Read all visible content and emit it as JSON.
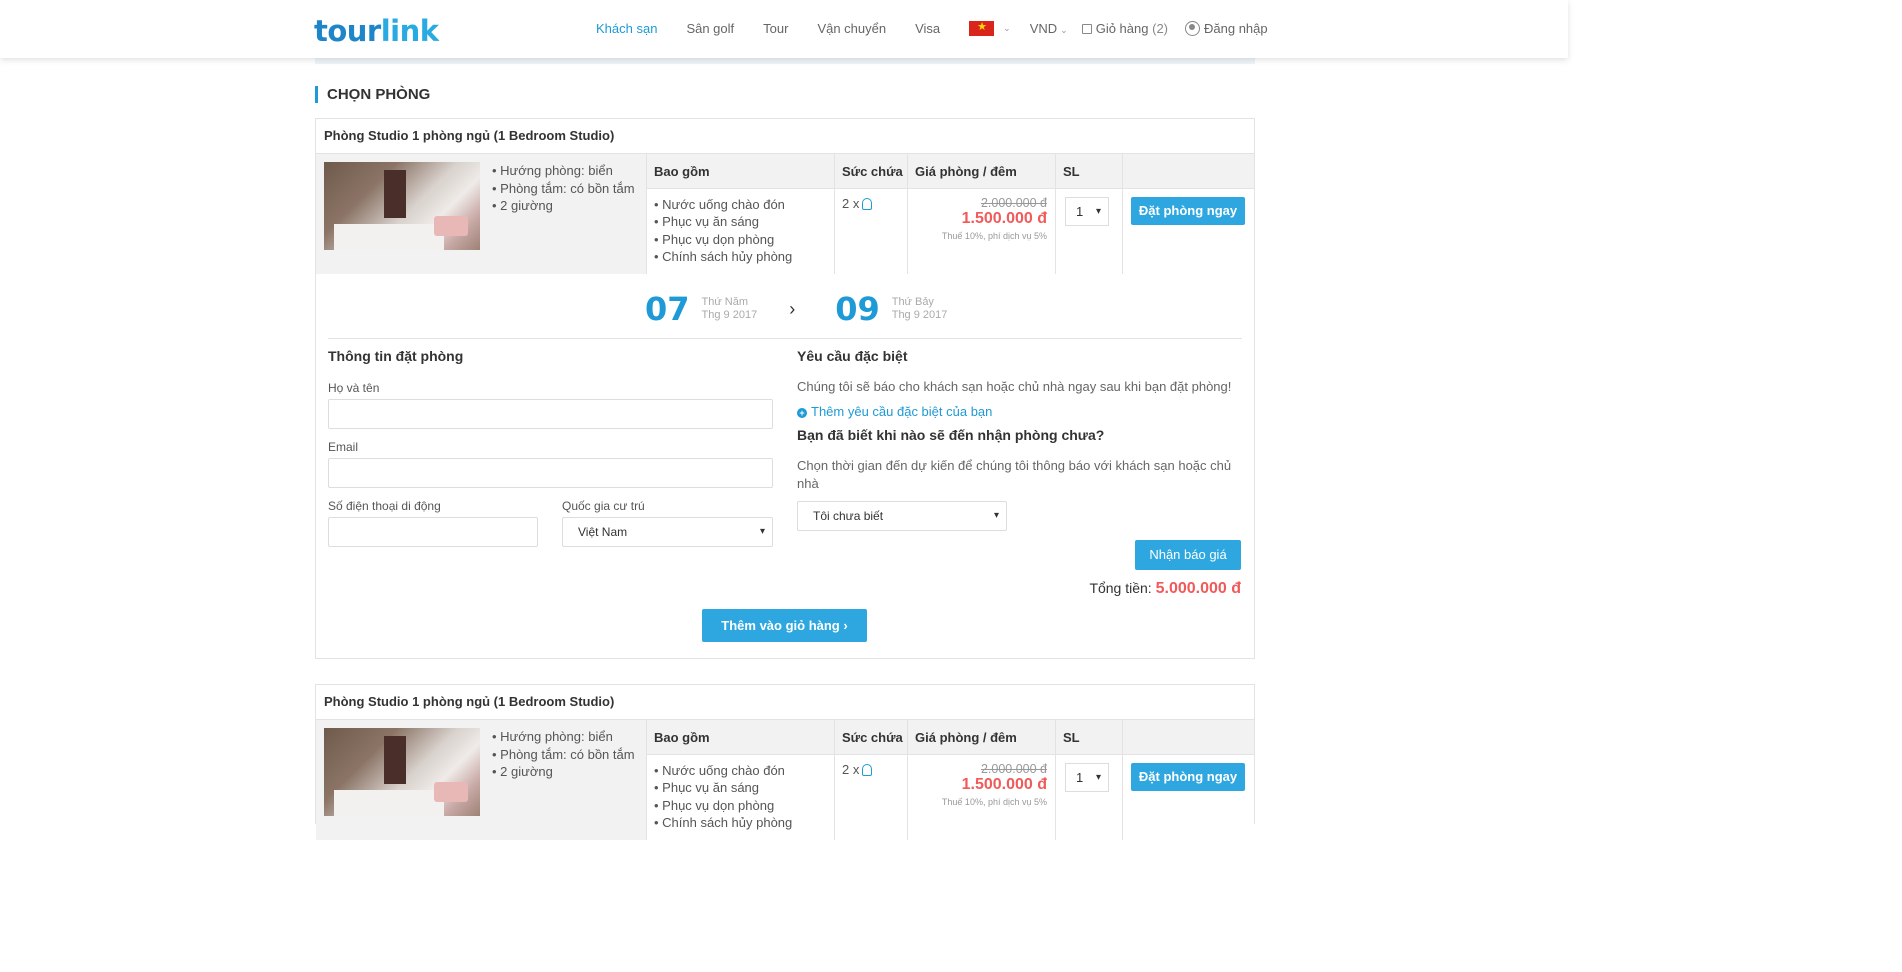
{
  "header": {
    "logo_part1": "tour",
    "logo_part2": "link",
    "nav": [
      "Khách sạn",
      "Sân golf",
      "Tour",
      "Vận chuyển",
      "Visa"
    ],
    "active_nav": "Khách sạn",
    "language_icon": "vietnam-flag-icon",
    "currency": "VND",
    "cart_label": "Giỏ hàng",
    "cart_count": "(2)",
    "login_label": "Đăng nhập"
  },
  "section_title": "CHỌN PHÒNG",
  "room_table_headers": {
    "includes": "Bao gồm",
    "capacity": "Sức chứa",
    "price": "Giá phòng / đêm",
    "qty": "SL"
  },
  "rooms": [
    {
      "title": "Phòng Studio 1 phòng ngủ (1 Bedroom Studio)",
      "features": [
        "• Hướng phòng: biển",
        "• Phòng tắm: có bồn tắm",
        "• 2 giường"
      ],
      "includes": [
        "• Nước uống chào đón",
        "• Phục vụ ăn sáng",
        "• Phục vụ dọn phòng",
        "• Chính sách hủy phòng"
      ],
      "capacity": "2 x",
      "old_price": "2.000.000 đ",
      "new_price": "1.500.000 đ",
      "tax_note": "Thuế 10%, phí dịch vụ 5%",
      "qty": "1",
      "book_label": "Đặt phòng ngay"
    },
    {
      "title": "Phòng Studio 1 phòng ngủ (1 Bedroom Studio)",
      "features": [
        "• Hướng phòng: biển",
        "• Phòng tắm: có bồn tắm",
        "• 2 giường"
      ],
      "includes": [
        "• Nước uống chào đón",
        "• Phục vụ ăn sáng",
        "• Phục vụ dọn phòng",
        "• Chính sách hủy phòng"
      ],
      "capacity": "2 x",
      "old_price": "2.000.000 đ",
      "new_price": "1.500.000 đ",
      "tax_note": "Thuế 10%, phí dịch vụ 5%",
      "qty": "1",
      "book_label": "Đặt phòng ngay"
    }
  ],
  "booking": {
    "checkin_day": "07",
    "checkin_weekday": "Thứ Năm",
    "checkin_month": "Thg 9 2017",
    "checkout_day": "09",
    "checkout_weekday": "Thứ Bảy",
    "checkout_month": "Thg 9 2017",
    "info_title": "Thông tin đặt phòng",
    "name_label": "Họ và tên",
    "name_value": "",
    "email_label": "Email",
    "email_value": "",
    "phone_label": "Số điện thoại di động",
    "phone_value": "",
    "country_label": "Quốc gia cư trú",
    "country_value": "Việt Nam",
    "special_title": "Yêu cầu đặc biệt",
    "special_text": "Chúng tôi sẽ báo cho khách sạn hoặc chủ nhà ngay sau khi bạn đặt phòng!",
    "special_link": "Thêm yêu cầu đặc biệt của bạn",
    "arrival_title": "Bạn đã biết khi nào sẽ đến nhận phòng chưa?",
    "arrival_text": "Chọn thời gian đến dự kiến để chúng tôi thông báo với khách sạn hoặc chủ nhà",
    "arrival_value": "Tôi chưa biết",
    "quote_button": "Nhận báo giá",
    "total_label": "Tổng tiền:",
    "total_value": "5.000.000 đ",
    "add_cart_button": "Thêm vào giỏ hàng ›"
  },
  "colors": {
    "accent": "#1e9ad6",
    "button": "#2ea7e0",
    "price": "#f05a5a"
  }
}
